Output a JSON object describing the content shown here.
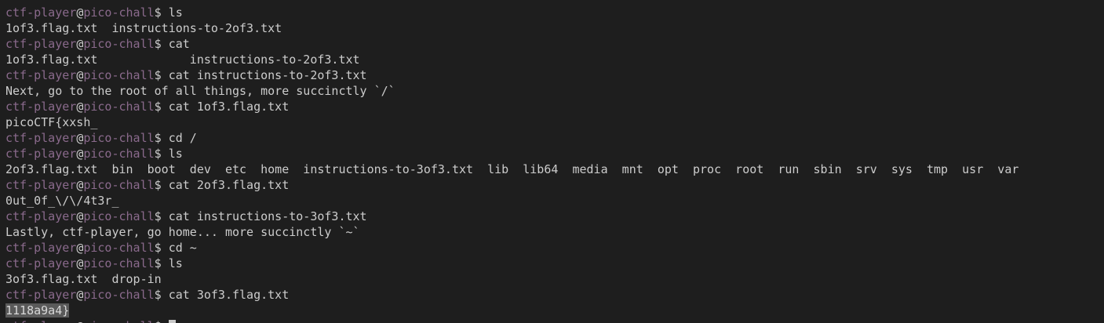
{
  "prompt": {
    "user": "ctf-player",
    "at": "@",
    "host": "pico-chall",
    "sigil": "$ "
  },
  "lines": [
    {
      "type": "prompt",
      "cmd": "ls"
    },
    {
      "type": "output",
      "text": "1of3.flag.txt  instructions-to-2of3.txt"
    },
    {
      "type": "prompt",
      "cmd": "cat"
    },
    {
      "type": "output",
      "text": "1of3.flag.txt             instructions-to-2of3.txt"
    },
    {
      "type": "prompt",
      "cmd": "cat instructions-to-2of3.txt"
    },
    {
      "type": "output",
      "text": "Next, go to the root of all things, more succinctly `/`"
    },
    {
      "type": "prompt",
      "cmd": "cat 1of3.flag.txt"
    },
    {
      "type": "output",
      "text": "picoCTF{xxsh_"
    },
    {
      "type": "prompt",
      "cmd": "cd /"
    },
    {
      "type": "prompt",
      "cmd": "ls"
    },
    {
      "type": "output",
      "text": "2of3.flag.txt  bin  boot  dev  etc  home  instructions-to-3of3.txt  lib  lib64  media  mnt  opt  proc  root  run  sbin  srv  sys  tmp  usr  var"
    },
    {
      "type": "prompt",
      "cmd": "cat 2of3.flag.txt"
    },
    {
      "type": "output",
      "text": "0ut_0f_\\/\\/4t3r_"
    },
    {
      "type": "prompt",
      "cmd": "cat instructions-to-3of3.txt"
    },
    {
      "type": "output",
      "text": "Lastly, ctf-player, go home... more succinctly `~`"
    },
    {
      "type": "prompt",
      "cmd": "cd ~"
    },
    {
      "type": "prompt",
      "cmd": "ls"
    },
    {
      "type": "output",
      "text": "3of3.flag.txt  drop-in"
    },
    {
      "type": "prompt",
      "cmd": "cat 3of3.flag.txt"
    },
    {
      "type": "output-highlight",
      "text": "1118a9a4}"
    },
    {
      "type": "prompt-active",
      "cmd": ""
    }
  ]
}
